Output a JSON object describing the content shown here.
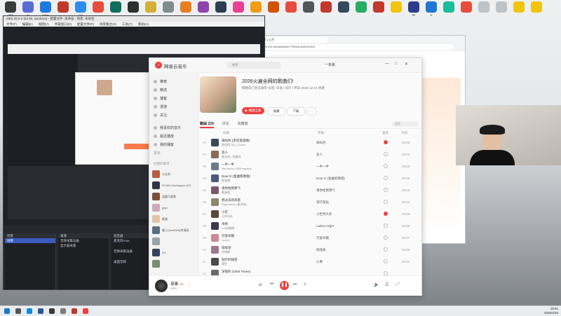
{
  "desktop": {
    "icons": [
      {
        "label": "OBS",
        "color": "#3b3b3b"
      },
      {
        "label": "AI",
        "color": "#5a6bd6"
      },
      {
        "label": "Edge",
        "color": "#1f7ae0"
      },
      {
        "label": "",
        "color": "#c0392b"
      },
      {
        "label": "QQ",
        "color": "#2d8cf0"
      },
      {
        "label": "",
        "color": "#e74c3c"
      },
      {
        "label": "",
        "color": "#0f6e5e"
      },
      {
        "label": "",
        "color": "#2f2f2f"
      },
      {
        "label": "",
        "color": "#d4af37"
      },
      {
        "label": "",
        "color": "#7f8c8d"
      },
      {
        "label": "",
        "color": "#e67e22"
      },
      {
        "label": "",
        "color": "#8e44ad"
      },
      {
        "label": "",
        "color": "#2c3e50"
      },
      {
        "label": "",
        "color": "#e84393"
      },
      {
        "label": "",
        "color": "#f39c12"
      },
      {
        "label": "",
        "color": "#d35400"
      },
      {
        "label": "",
        "color": "#e74c3c"
      },
      {
        "label": "",
        "color": "#555"
      },
      {
        "label": "",
        "color": "#c0392b"
      },
      {
        "label": "",
        "color": "#34495e"
      },
      {
        "label": "",
        "color": "#27ae60"
      },
      {
        "label": "",
        "color": "#c0392b"
      },
      {
        "label": "",
        "color": "#f1c40f"
      },
      {
        "label": "SF",
        "color": "#2d3e8c"
      },
      {
        "label": "K",
        "color": "#1f78d1"
      },
      {
        "label": "",
        "color": "#1abc9c"
      },
      {
        "label": "",
        "color": "#e74c3c"
      },
      {
        "label": "",
        "color": "#bdc3c7"
      },
      {
        "label": "",
        "color": "#bdc3c7"
      },
      {
        "label": "",
        "color": "#f1c40f"
      },
      {
        "label": "",
        "color": "#f1c40f"
      },
      {
        "label": "",
        "color": "#ecf0f1"
      }
    ]
  },
  "obs": {
    "title": "OBS 29.0.2 (64-bit, windows) - 配置文件: 未命名 - 场景: 未命名",
    "menu": [
      "文件(F)",
      "编辑(E)",
      "视图(V)",
      "停靠窗口(D)",
      "配置文件(P)",
      "场景集合(S)",
      "工具(T)",
      "帮助(H)"
    ],
    "source_bar": "未选择源",
    "btn_props": "属性",
    "btn_filter": "滤镜",
    "docks": {
      "scenes": {
        "title": "场景",
        "items": [
          "场景"
        ]
      },
      "sources": {
        "title": "来源",
        "items": [
          "音频采集设备",
          "显示器采集"
        ]
      },
      "mixer": {
        "title": "混音器",
        "items": [
          "麦克风/Aux",
          "音频采集设备",
          "桌面音频"
        ]
      }
    }
  },
  "music": {
    "brand": "网易云音乐",
    "search_placeholder": "搜索",
    "user": "一条路",
    "sidebar": {
      "items": [
        "推荐",
        "精选",
        "播客",
        "漫游",
        "关注"
      ],
      "my_items": [
        "我喜欢的音乐",
        "最近播放",
        "我的播客"
      ],
      "more": "更多",
      "created_title": "创建的歌单",
      "playlists": [
        {
          "name": "大吉利",
          "color": "#b55f41"
        },
        {
          "name": "DJ Mix Kanhappen (DJ...",
          "color": "#303341"
        },
        {
          "name": "温暖可爱歌",
          "color": "#7a4f3a"
        },
        {
          "name": "jpop",
          "color": "#d0a9b9"
        },
        {
          "name": "歌曲",
          "color": "#e0c5a6"
        },
        {
          "name": "春三(Zen8025)李清辰",
          "color": "#5a6e7e"
        },
        {
          "name": "",
          "color": "#9aa3a8"
        },
        {
          "name": "D3",
          "color": "#35435a"
        },
        {
          "name": "",
          "color": "#7b8a70"
        }
      ]
    },
    "playlist": {
      "title": "2026火遍全网的歌曲们!",
      "meta": "网络热门音乐歌单  标签: 华语 / 流行 / 怀旧  2025-12-10 创建",
      "btn_play": "播放全部",
      "btn_collect": "收藏",
      "btn_download": "下载",
      "btn_more": "···"
    },
    "tabs": [
      "歌曲 229",
      "评论",
      "收藏者"
    ],
    "table_search": "搜索",
    "table_head": {
      "title": "标题",
      "album": "专辑",
      "like": "喜欢",
      "duration": "时长"
    },
    "songs": [
      {
        "n": "01",
        "title": "海屿你 (李佳琪演绎)",
        "artist": "李佳琪 马上_Crash",
        "album": "海屿你",
        "liked": true,
        "dur": "04:03",
        "color": "#3a4a5a"
      },
      {
        "n": "02",
        "title": "恶人",
        "artist": "林志炫 / 张嘉倪",
        "album": "恶人",
        "liked": false,
        "dur": "03:04",
        "color": "#8a6a5a"
      },
      {
        "n": "03",
        "title": "一半一半",
        "artist": "Tep Berry / R8Company",
        "album": "一半一半",
        "liked": false,
        "dur": "03:53",
        "color": "#6a7a8a"
      },
      {
        "n": "04",
        "title": "Dear D (金曲新歌版)",
        "artist": "陈思晴",
        "album": "Dear D (金曲新歌版)",
        "liked": false,
        "dur": "03:45",
        "color": "#4a5a7a"
      },
      {
        "n": "05",
        "title": "请你给我勇气",
        "artist": "黄涵若",
        "album": "请你给我勇气",
        "liked": false,
        "dur": "03:12",
        "color": "#7a5a6a"
      },
      {
        "n": "06",
        "title": "把过去的风景",
        "artist": "Rayy Alven (黄诗弦)",
        "album": "渐行渐远",
        "liked": false,
        "dur": "04:01",
        "color": "#8a8a6a"
      },
      {
        "n": "07",
        "title": "小年",
        "artist": "小年乐队",
        "album": "小世界大年",
        "liked": true,
        "dur": "04:00",
        "color": "#5a4a3a"
      },
      {
        "n": "08",
        "title": "吊桥",
        "artist": "Luo加咖啡",
        "album": "Ladies Night",
        "liked": false,
        "dur": "03:58",
        "color": "#3a3a4a"
      },
      {
        "n": "09",
        "title": "可爱冰糖",
        "artist": "Leo(1)",
        "album": "可爱冰糖",
        "liked": false,
        "dur": "02:47",
        "color": "#c88a9a"
      },
      {
        "n": "10",
        "title": "绯绯染",
        "artist": "许峥嵘",
        "album": "绯绯染",
        "liked": false,
        "dur": "03:33",
        "color": "#9a7a8a"
      },
      {
        "n": "11",
        "title": "别叶的秘密",
        "artist": "理世",
        "album": "心事",
        "liked": false,
        "dur": "03:21",
        "color": "#4a4a4a"
      },
      {
        "n": "12",
        "title": "深夜的 (1000 Times)",
        "artist": "",
        "album": "",
        "liked": false,
        "dur": "",
        "color": "#6a6a6a"
      }
    ],
    "now_playing": {
      "title": "孤雏",
      "artist": "AGA",
      "tag": "VIP"
    }
  },
  "browser": {
    "address": "/#?quickid=1a37c52-ab0da968bc77f9034ea4400f1601",
    "tab": "Ruo-ai 获取方式 | 公开"
  },
  "taskbar": {
    "time": "19:01",
    "date": "2026/4/16"
  }
}
